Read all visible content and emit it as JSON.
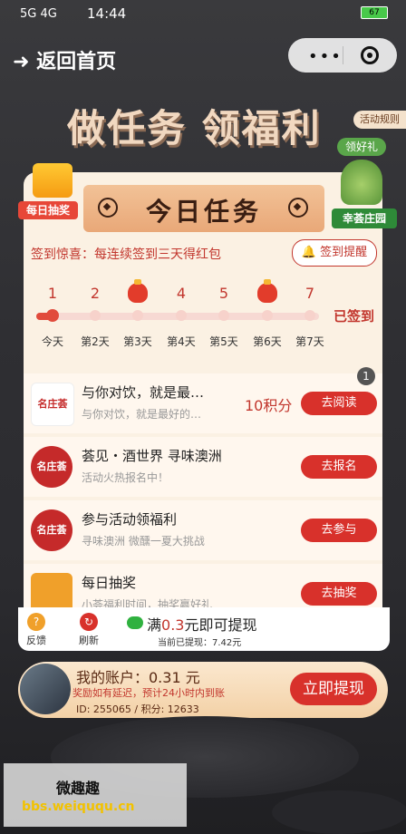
{
  "status": {
    "signal": "5G 4G",
    "time": "14:44",
    "battery": "67"
  },
  "nav": {
    "back_label": "返回首页"
  },
  "page_title": "做任务 领福利",
  "rules_label": "活动规则",
  "gift_label": "每日抽奖",
  "grape": {
    "top_label": "领好礼",
    "bottom_label": "幸荟庄园"
  },
  "card_title": "今日任务",
  "signin": {
    "surprise_text": "签到惊喜：每连续签到三天得红包",
    "remind_label": "签到提醒",
    "numbers": [
      "1",
      "2",
      "",
      "4",
      "5",
      "",
      "7"
    ],
    "days": [
      "今天",
      "第2天",
      "第3天",
      "第4天",
      "第5天",
      "第6天",
      "第7天"
    ],
    "signed_label": "已签到",
    "progress_day": 1
  },
  "tasks": [
    {
      "logo": "名庄荟",
      "title": "与你对饮，就是最…",
      "subtitle": "与你对饮，就是最好的…",
      "points": "10积分",
      "button": "去阅读",
      "badge": "1"
    },
    {
      "logo": "名庄荟",
      "title": "荟见・酒世界 寻味澳洲",
      "subtitle": "活动火热报名中！",
      "points": "",
      "button": "去报名"
    },
    {
      "logo": "名庄荟",
      "title": "参与活动领福利",
      "subtitle": "寻味澳洲 微醺一夏大挑战",
      "points": "",
      "button": "去参与"
    },
    {
      "logo": "",
      "title": "每日抽奖",
      "subtitle": "小荟福利时间，抽奖赢好礼",
      "points": "",
      "button": "去抽奖"
    }
  ],
  "bottom": {
    "feedback": "反馈",
    "refresh": "刷新",
    "full_prefix": "满",
    "full_amount": "0.3",
    "full_suffix": "元即可提现",
    "already": "当前已提现：7.42元"
  },
  "account": {
    "title": "我的账户：0.31 元",
    "note": "奖励如有延迟，预计24小时内到账",
    "id_line": "ID: 255065  /  积分: 12633",
    "withdraw_label": "立即提现"
  },
  "watermark": {
    "line1": "微趣趣",
    "line2": "bbs.weiququ.cn"
  },
  "colors": {
    "accent": "#d8312b",
    "card_bg": "#fbf1e3",
    "header_gold": "#e9a878"
  }
}
